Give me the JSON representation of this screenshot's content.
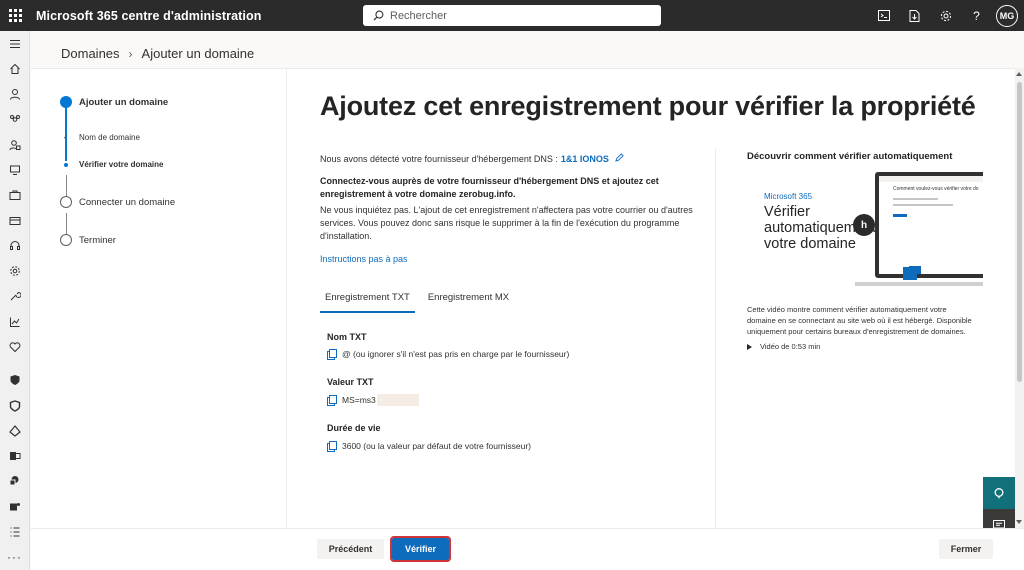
{
  "header": {
    "app_title": "Microsoft 365 centre d'administration",
    "search_placeholder": "Rechercher",
    "user_initials": "MG"
  },
  "breadcrumb": {
    "parent": "Domaines",
    "current": "Ajouter un domaine"
  },
  "stepper": {
    "steps": [
      {
        "label": "Ajouter un domaine",
        "state": "current"
      },
      {
        "label": "Nom de domaine",
        "state": "done-substep"
      },
      {
        "label": "Vérifier votre domaine",
        "state": "current-substep"
      },
      {
        "label": "Connecter un domaine",
        "state": "pending"
      },
      {
        "label": "Terminer",
        "state": "pending"
      }
    ]
  },
  "main": {
    "title": "Ajoutez cet enregistrement pour vérifier la propriété",
    "detected_prefix": "Nous avons détecté votre fournisseur d'hébergement DNS :",
    "provider": "1&1 IONOS",
    "connect_text": "Connectez-vous auprès de votre fournisseur d'hébergement DNS et ajoutez cet enregistrement à votre domaine zerobug.info.",
    "info_text": "Ne vous inquiétez pas. L'ajout de cet enregistrement n'affectera pas votre courrier ou d'autres services. Vous pouvez donc sans risque le supprimer à la fin de l'exécution du programme d'installation.",
    "instructions_link": "Instructions pas à pas",
    "tabs": [
      {
        "label": "Enregistrement TXT",
        "active": true
      },
      {
        "label": "Enregistrement MX",
        "active": false
      }
    ],
    "fields": [
      {
        "label": "Nom TXT",
        "value": "@ (ou ignorer s'il n'est pas pris en charge par le fournisseur)"
      },
      {
        "label": "Valeur TXT",
        "value": "MS=ms3"
      },
      {
        "label": "Durée de vie",
        "value": "3600 (ou la valeur par défaut de votre fournisseur)"
      }
    ]
  },
  "video": {
    "title": "Découvrir comment vérifier automatiquement",
    "thumb_brand": "Microsoft 365",
    "thumb_heading": "Vérifier automatiquement votre domaine",
    "thumb_screen_text": "Comment voulez-vous vérifier votre do",
    "description": "Cette vidéo montre comment vérifier automatiquement votre domaine en se connectant au site web où il est hébergé. Disponible uniquement pour certains bureaux d'enregistrement de domaines.",
    "duration": "Vidéo de 0:53 min"
  },
  "footer": {
    "prev_label": "Précédent",
    "verify_label": "Vérifier",
    "close_label": "Fermer"
  },
  "colors": {
    "accent": "#0f6cbd",
    "topbar": "#2b2b2b",
    "highlight_outline": "#d13438",
    "float_teal": "#11707a"
  }
}
